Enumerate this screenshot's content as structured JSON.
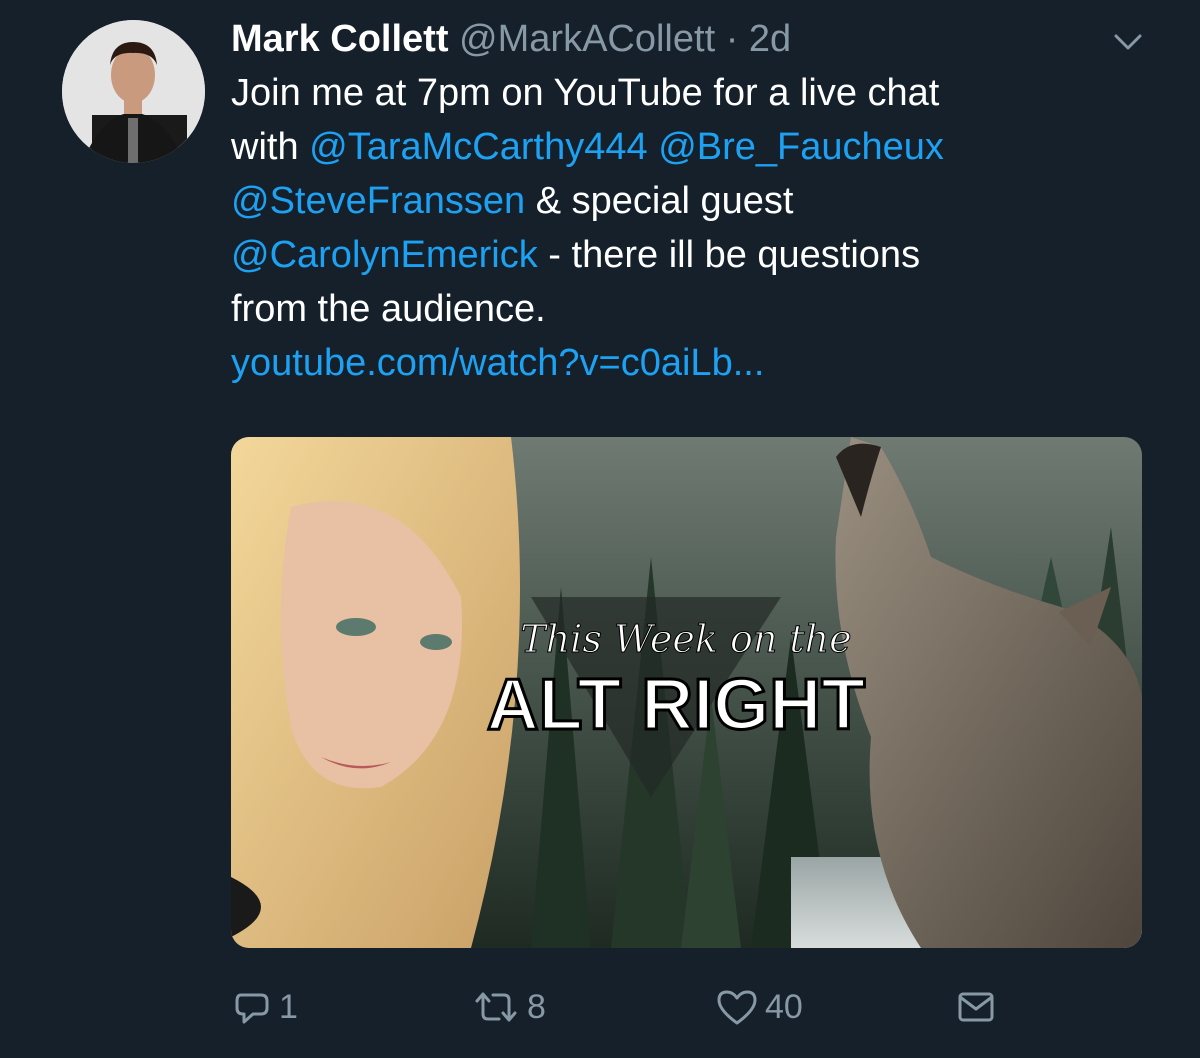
{
  "tweet": {
    "display_name": "Mark Collett",
    "handle": "@MarkACollett",
    "separator": "·",
    "time": "2d",
    "text_line1": "Join me at 7pm on YouTube for a live chat",
    "with_word": "with ",
    "mention_1": "@TaraMcCarthy444",
    "mention_2": "@Bre_Faucheux",
    "mention_3": "@SteveFranssen",
    "special_guest": " & special guest",
    "mention_4": "@CarolynEmerick",
    "text_after_mention4": " - there ill be questions",
    "text_line5": "from the audience.",
    "link": "youtube.com/watch?v=c0aiLb...",
    "media": {
      "title_script": "This Week on the",
      "title_main": "ALT RIGHT"
    },
    "actions": {
      "reply_count": "1",
      "retweet_count": "8",
      "like_count": "40"
    }
  },
  "colors": {
    "background": "#15202b",
    "link": "#1da1f2",
    "muted": "#8899a6"
  },
  "icons": [
    "reply-icon",
    "retweet-icon",
    "like-icon",
    "message-icon",
    "chevron-down-icon"
  ]
}
